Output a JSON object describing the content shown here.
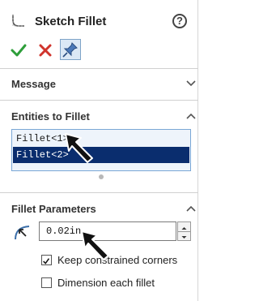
{
  "header": {
    "title": "Sketch Fillet",
    "help_glyph": "?"
  },
  "actions": {
    "ok_icon": "checkmark-icon",
    "cancel_icon": "x-icon",
    "pin_icon": "pushpin-icon"
  },
  "sections": {
    "message": {
      "title": "Message",
      "state": "collapsed"
    },
    "entities": {
      "title": "Entities to Fillet",
      "state": "expanded",
      "items": [
        {
          "label": "Fillet<1>",
          "selected": false
        },
        {
          "label": "Fillet<2>",
          "selected": true
        }
      ]
    },
    "params": {
      "title": "Fillet Parameters",
      "state": "expanded",
      "radius_value": "0.02in",
      "checkboxes": [
        {
          "label": "Keep constrained corners",
          "checked": true
        },
        {
          "label": "Dimension each fillet",
          "checked": false
        }
      ]
    }
  },
  "colors": {
    "accent": "#0a2d6e",
    "ok_green": "#2e9e3a",
    "cancel_red": "#d0342c"
  }
}
